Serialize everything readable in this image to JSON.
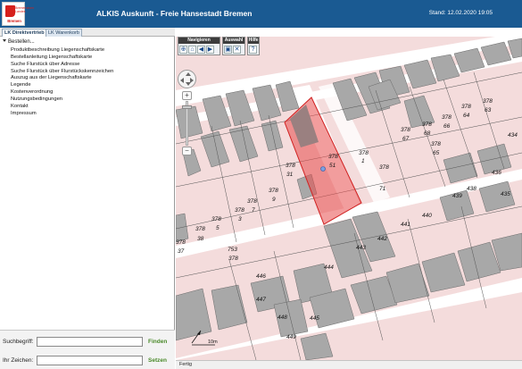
{
  "header": {
    "logo_text": "Bremen",
    "logo_small": "Bremerhaven Landes",
    "title": "ALKIS  Auskunft - Freie Hansestadt Bremen",
    "status": "Stand: 12.02.2020 19:05"
  },
  "tabs": [
    {
      "label": "LK Direktvertrieb"
    },
    {
      "label": "LK Warenkorb"
    }
  ],
  "sidebar": {
    "root": "Bestellen...",
    "items": [
      "Produktbeschreibung Liegenschaftskarte",
      "Bestellanleitung Liegenschaftskarte",
      "Suche Flurstück über Adresse",
      "Suche Flurstück über Flurstückskennzeichen",
      "Auszug aus der Liegenschaftskarte",
      "Legende",
      "Kostenverordnung",
      "Nutzungsbedingungen",
      "Kontakt",
      "Impressum"
    ]
  },
  "search": {
    "label1": "Suchbegriff:",
    "button1": "Finden",
    "value1": "",
    "label2": "Ihr Zeichen:",
    "button2": "Setzen",
    "value2": ""
  },
  "toolbar": {
    "groups": [
      {
        "label": "Navigieren",
        "buttons": [
          "zoom-in-icon",
          "home-icon",
          "back-icon",
          "forward-icon"
        ]
      },
      {
        "label": "Auswahl",
        "buttons": [
          "select-icon",
          "print-icon",
          "delete-icon"
        ]
      },
      {
        "label": "Hilfe",
        "buttons": [
          "help-icon"
        ]
      }
    ]
  },
  "map": {
    "scale_label": "10m",
    "parcel_labels": [
      {
        "num": "378",
        "sub": "51"
      },
      {
        "num": "378",
        "sub": "31"
      },
      {
        "num": "378",
        "sub": "9"
      },
      {
        "num": "378",
        "sub": "7"
      },
      {
        "num": "378",
        "sub": "5"
      },
      {
        "num": "378",
        "sub": "3"
      },
      {
        "num": "378",
        "sub": "38"
      },
      {
        "num": "378",
        "sub": "37"
      },
      {
        "num": "378",
        "sub": "1"
      },
      {
        "num": "378",
        "sub": "67"
      },
      {
        "num": "378",
        "sub": "68"
      },
      {
        "num": "378",
        "sub": "65"
      },
      {
        "num": "378",
        "sub": "66"
      },
      {
        "num": "378",
        "sub": "64"
      },
      {
        "num": "378",
        "sub": "63"
      },
      {
        "num": "378",
        "sub": "71"
      },
      {
        "num": "753",
        "sub": "378"
      }
    ],
    "numbers": [
      "446",
      "447",
      "448",
      "449",
      "445",
      "444",
      "443",
      "442",
      "441",
      "440",
      "439",
      "438",
      "436",
      "435",
      "434"
    ]
  },
  "status": {
    "text": "Fertig"
  },
  "colors": {
    "header": "#1a5a92",
    "parcel_fill": "#f4dcdc",
    "building": "#a8a8a8",
    "selection": "#e84c4c"
  }
}
